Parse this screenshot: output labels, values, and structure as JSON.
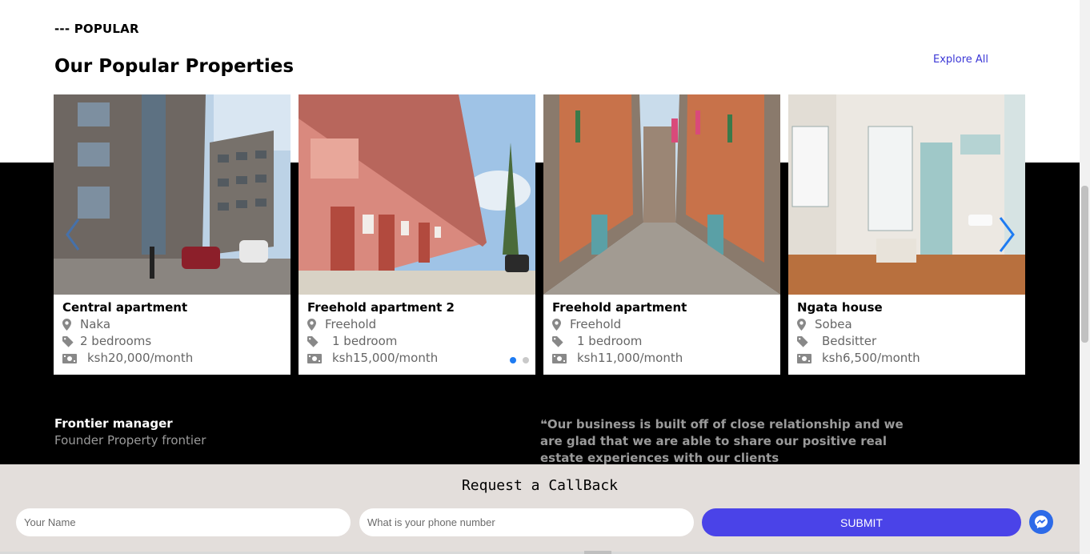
{
  "popular": {
    "kicker": "--- POPULAR",
    "title": "Our Popular Properties",
    "explore_label": "Explore All",
    "accent": "#3b37d6"
  },
  "properties": [
    {
      "name": "Central apartment",
      "location": "Naka",
      "size": "2 bedrooms",
      "price": "ksh20,000/month"
    },
    {
      "name": "Freehold apartment 2",
      "location": "Freehold",
      "size": "1 bedroom",
      "price": "ksh15,000/month"
    },
    {
      "name": "Freehold apartment",
      "location": "Freehold",
      "size": "1 bedroom",
      "price": "ksh11,000/month"
    },
    {
      "name": "Ngata house",
      "location": "Sobea",
      "size": "Bedsitter",
      "price": "ksh6,500/month"
    }
  ],
  "carousel": {
    "pages": 2,
    "active_page": 1,
    "arrow_color": "#1e7bf2"
  },
  "testimonial": {
    "name": "Frontier manager",
    "role": "Founder Property frontier",
    "quote": "Our business is built off of close relationship and we are glad that we are able to share our positive real estate experiences with our clients"
  },
  "callback": {
    "title": "Request a CallBack",
    "name_placeholder": "Your Name",
    "phone_placeholder": "What is your phone number",
    "submit_label": "SUBMIT",
    "submit_color": "#4a43e8",
    "messenger_color": "#2d6ae8"
  },
  "icons": {
    "location": "map-marker-icon",
    "size": "tag-icon",
    "price": "money-icon",
    "quote": "quote-icon",
    "messenger": "messenger-icon",
    "next": "chevron-right-icon",
    "prev": "chevron-left-icon"
  }
}
